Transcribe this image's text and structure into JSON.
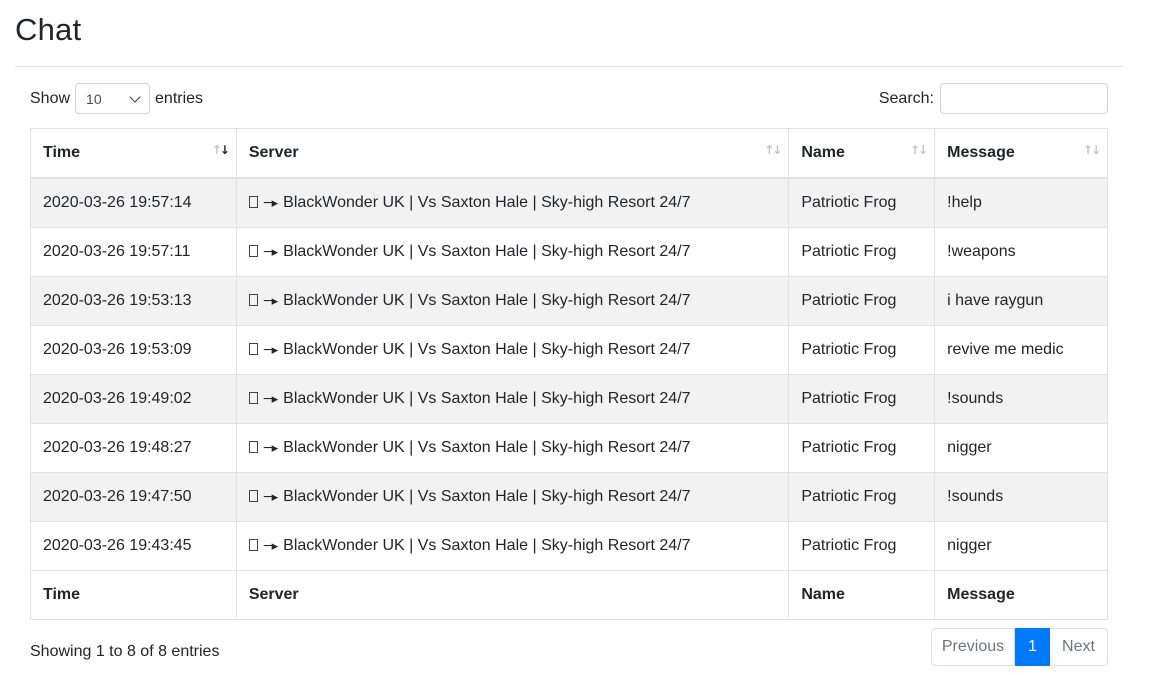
{
  "page": {
    "title": "Chat"
  },
  "length_control": {
    "prefix": "Show",
    "selected": "10",
    "suffix": "entries"
  },
  "search": {
    "label": "Search:",
    "value": ""
  },
  "table": {
    "columns": [
      "Time",
      "Server",
      "Name",
      "Message"
    ],
    "rows": [
      {
        "time": "2020-03-26 19:57:14",
        "server": "BlackWonder UK | Vs Saxton Hale | Sky-high Resort 24/7",
        "name": "Patriotic Frog",
        "message": "!help"
      },
      {
        "time": "2020-03-26 19:57:11",
        "server": "BlackWonder UK | Vs Saxton Hale | Sky-high Resort 24/7",
        "name": "Patriotic Frog",
        "message": "!weapons"
      },
      {
        "time": "2020-03-26 19:53:13",
        "server": "BlackWonder UK | Vs Saxton Hale | Sky-high Resort 24/7",
        "name": "Patriotic Frog",
        "message": "i have raygun"
      },
      {
        "time": "2020-03-26 19:53:09",
        "server": "BlackWonder UK | Vs Saxton Hale | Sky-high Resort 24/7",
        "name": "Patriotic Frog",
        "message": "revive me medic"
      },
      {
        "time": "2020-03-26 19:49:02",
        "server": "BlackWonder UK | Vs Saxton Hale | Sky-high Resort 24/7",
        "name": "Patriotic Frog",
        "message": "!sounds"
      },
      {
        "time": "2020-03-26 19:48:27",
        "server": "BlackWonder UK | Vs Saxton Hale | Sky-high Resort 24/7",
        "name": "Patriotic Frog",
        "message": "nigger"
      },
      {
        "time": "2020-03-26 19:47:50",
        "server": "BlackWonder UK | Vs Saxton Hale | Sky-high Resort 24/7",
        "name": "Patriotic Frog",
        "message": "!sounds"
      },
      {
        "time": "2020-03-26 19:43:45",
        "server": "BlackWonder UK | Vs Saxton Hale | Sky-high Resort 24/7",
        "name": "Patriotic Frog",
        "message": "nigger"
      }
    ],
    "sort": {
      "column": "Time",
      "direction": "descending"
    }
  },
  "info": {
    "text": "Showing 1 to 8 of 8 entries"
  },
  "pagination": {
    "previous": "Previous",
    "current": "1",
    "next": "Next"
  },
  "icons": {
    "flag_prefix": "flag-placeholder-icon",
    "pennant": "pennant-icon",
    "sort": "sort-arrows-icon"
  },
  "colors": {
    "accent": "#007bff",
    "stripe": "#f2f2f2",
    "border": "#dee2e6"
  }
}
